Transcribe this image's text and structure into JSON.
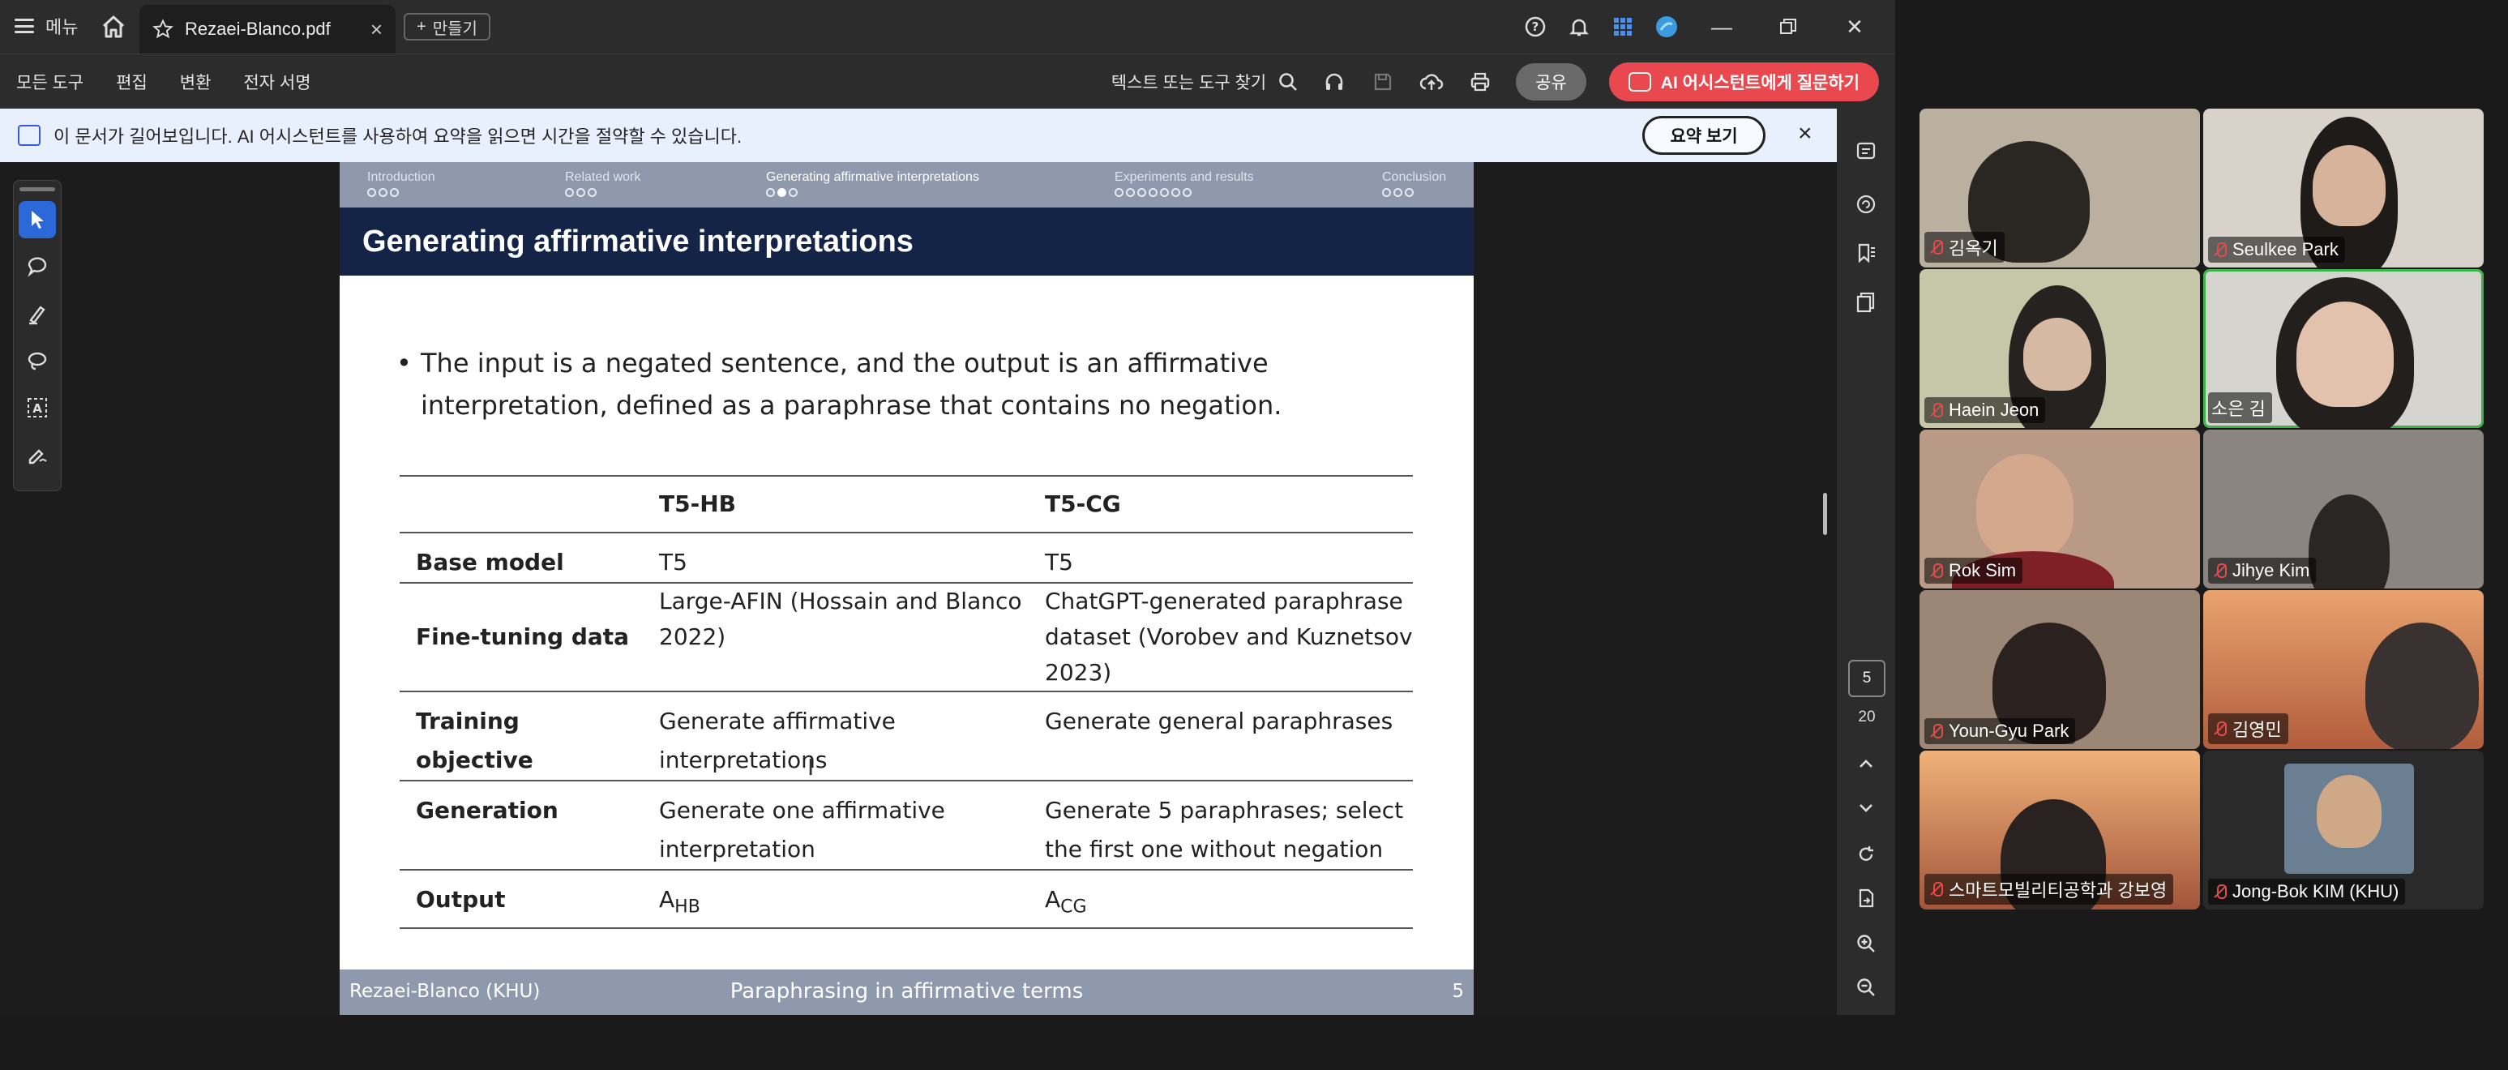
{
  "titlebar": {
    "menu_label": "메뉴",
    "tab_title": "Rezaei-Blanco.pdf",
    "new_tab_label": "만들기"
  },
  "toolbar": {
    "menu_items": [
      "모든 도구",
      "편집",
      "변환",
      "전자 서명"
    ],
    "find_label": "텍스트 또는 도구 찾기",
    "share_label": "공유",
    "ai_label": "AI 어시스턴트에게 질문하기"
  },
  "notice": {
    "text": "이 문서가 길어보입니다. AI 어시스턴트를 사용하여 요약을 읽으면 시간을 절약할 수 있습니다.",
    "button_label": "요약 보기",
    "close_label": "×"
  },
  "pager": {
    "current_page": "5",
    "total_pages": "20"
  },
  "slide": {
    "nav": [
      {
        "label": "Introduction",
        "dots": 3,
        "filled": -1
      },
      {
        "label": "Related work",
        "dots": 3,
        "filled": -1
      },
      {
        "label": "Generating affirmative interpretations",
        "dots": 3,
        "filled": 1
      },
      {
        "label": "Experiments and results",
        "dots": 7,
        "filled": -1
      },
      {
        "label": "Conclusion",
        "dots": 3,
        "filled": -1
      }
    ],
    "title": "Generating affirmative interpretations",
    "bullet": "The input is a negated sentence, and the output is an affirmative interpretation, defined as a paraphrase that contains no negation.",
    "table": {
      "headers": [
        "",
        "T5-HB",
        "T5-CG"
      ],
      "rows": [
        {
          "label": "Base model",
          "hb": "T5",
          "cg": "T5"
        },
        {
          "label": "Fine-tuning data",
          "hb": "Large-AFIN (Hossain and Blanco 2022)",
          "cg": "ChatGPT-generated paraphrase dataset (Vorobev and Kuznetsov 2023)"
        },
        {
          "label": "Training objective",
          "hb": "Generate affirmative interpretations",
          "cg": "Generate general paraphrases"
        },
        {
          "label": "Generation",
          "hb": "Generate one affirmative interpretation",
          "cg": "Generate 5 paraphrases; select the first one without negation"
        },
        {
          "label": "Output",
          "hb_base": "A",
          "hb_sub": "HB",
          "cg_base": "A",
          "cg_sub": "CG"
        }
      ]
    },
    "footer": {
      "left": "Rezaei-Blanco (KHU)",
      "center": "Paraphrasing in affirmative terms",
      "page": "5"
    }
  },
  "participants": [
    {
      "name": "김옥기",
      "muted": true,
      "bg": "#b9b0a0"
    },
    {
      "name": "Seulkee Park",
      "muted": true,
      "bg": "#d8d2ca"
    },
    {
      "name": "Haein Jeon",
      "muted": true,
      "bg": "#c5c7a8"
    },
    {
      "name": "소은 김",
      "muted": false,
      "bg": "#d6d4cf"
    },
    {
      "name": "Rok Sim",
      "muted": true,
      "bg": "#b89a86"
    },
    {
      "name": "Jihye Kim",
      "muted": true,
      "bg": "#8a8580"
    },
    {
      "name": "Youn-Gyu Park",
      "muted": true,
      "bg": "#9c8777"
    },
    {
      "name": "김영민",
      "muted": true,
      "bg": "#c88a6a"
    },
    {
      "name": "스마트모빌리티공학과 강보영",
      "muted": true,
      "bg": "#c7926b"
    },
    {
      "name": "Jong-Bok KIM (KHU)",
      "muted": true,
      "bg": "#2a2a2a"
    }
  ],
  "colors": {
    "accent_blue": "#2c68d8",
    "ai_red": "#e8484e",
    "slide_title_band": "#132447",
    "slide_nav": "#8e99ad",
    "speaking_green": "#3ab54a"
  }
}
